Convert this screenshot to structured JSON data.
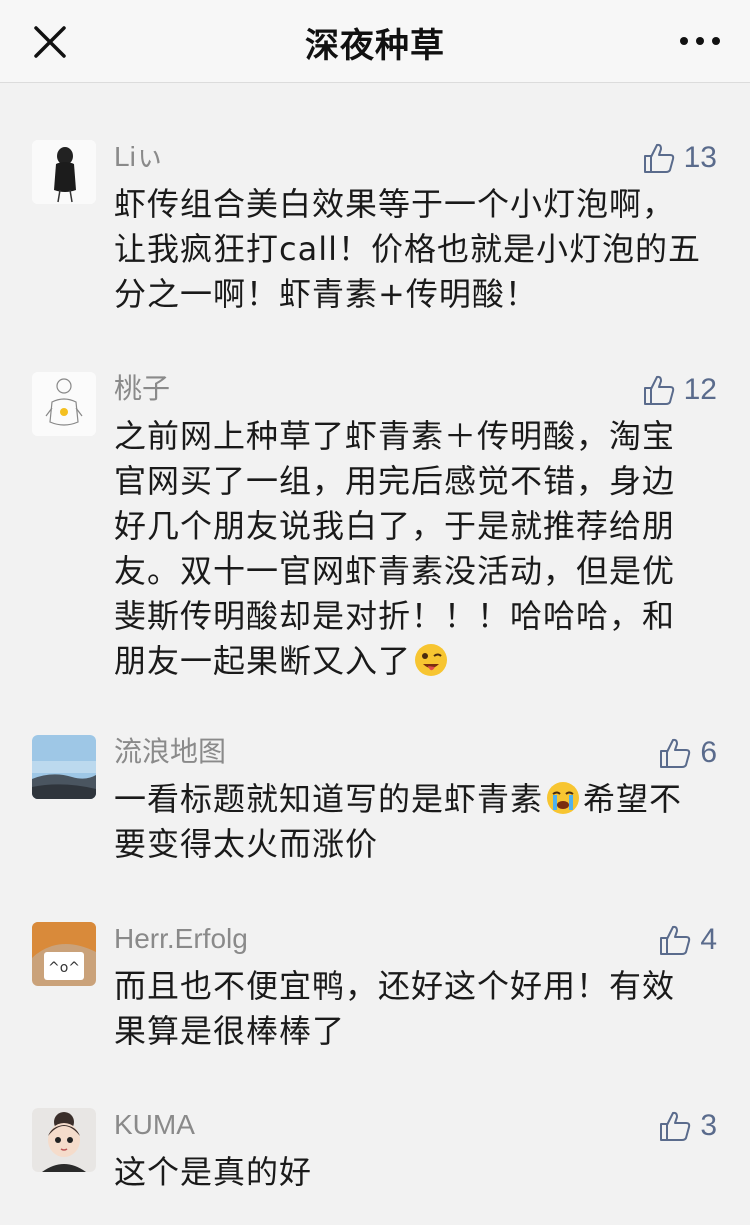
{
  "header": {
    "title": "深夜种草",
    "close_icon": "close-icon",
    "more_icon": "more-dots-icon"
  },
  "colors": {
    "like": "#5a6b8c",
    "username": "#8a8a8a",
    "background": "#f2f2f2"
  },
  "comments": [
    {
      "user": "Liぃ",
      "likes": "13",
      "text": "虾传组合美白效果等于一个小灯泡啊，让我疯狂打call！价格也就是小灯泡的五分之一啊！虾青素+传明酸！"
    },
    {
      "user": "桃子",
      "likes": "12",
      "text": "之前网上种草了虾青素＋传明酸，淘宝官网买了一组，用完后感觉不错，身边好几个朋友说我白了，于是就推荐给朋友。双十一官网虾青素没活动，但是优斐斯传明酸却是对折！！！哈哈哈，和朋友一起果断又入了",
      "emoji": "winking-tongue-emoji"
    },
    {
      "user": "流浪地图",
      "likes": "6",
      "text_part1": "一看标题就知道写的是虾青素",
      "emoji": "crying-emoji",
      "text_part2": "希望不要变得太火而涨价"
    },
    {
      "user": "Herr.Erfolg",
      "likes": "4",
      "text": "而且也不便宜鸭，还好这个好用！有效果算是很棒棒了"
    },
    {
      "user": "KUMA",
      "likes": "3",
      "text": "这个是真的好"
    }
  ]
}
